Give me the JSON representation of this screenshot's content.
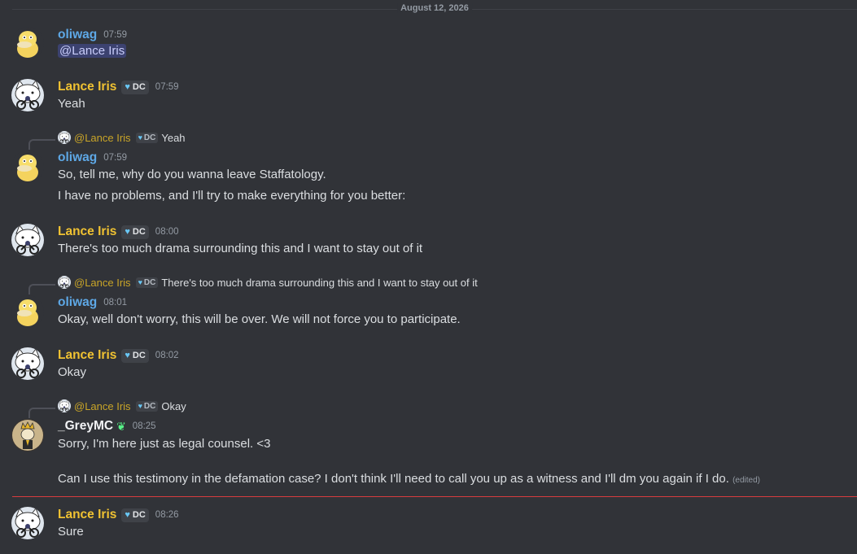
{
  "date_divider": "August 12, 2026",
  "users": {
    "oliwag": {
      "name": "oliwag"
    },
    "lance": {
      "name": "Lance Iris",
      "tag": "DC",
      "mention": "@Lance Iris"
    },
    "grey": {
      "name": "_GreyMC"
    }
  },
  "messages": [
    {
      "author": "oliwag",
      "time": "07:59",
      "text": "@Lance Iris"
    },
    {
      "author": "Lance Iris",
      "time": "07:59",
      "text": "Yeah"
    },
    {
      "author": "oliwag",
      "time": "07:59",
      "reply_text": "Yeah",
      "lines": [
        "So, tell me, why do you wanna leave Staffatology.",
        "I have no problems, and I'll try to make everything for you better:"
      ]
    },
    {
      "author": "Lance Iris",
      "time": "08:00",
      "text": "There's too much drama surrounding this and I want to stay out of it"
    },
    {
      "author": "oliwag",
      "time": "08:01",
      "reply_text": "There's too much drama surrounding this and I want to stay out of it",
      "text": "Okay, well don't worry, this will be over. We will not force you to participate."
    },
    {
      "author": "Lance Iris",
      "time": "08:02",
      "text": "Okay"
    },
    {
      "author": "_GreyMC",
      "time": "08:25",
      "reply_text": "Okay",
      "lines": [
        "Sorry, I'm here just as legal counsel. <3",
        "Can I use this testimony in the defamation case? I don't think I'll need to call you up as a witness and I'll dm you again if I do."
      ],
      "edited": "(edited)"
    },
    {
      "author": "Lance Iris",
      "time": "08:26",
      "text": "Sure"
    }
  ],
  "colors": {
    "background": "#313338",
    "oliwag": "#5ea8e6",
    "lance": "#f0c232",
    "new_divider": "#d83c3e"
  }
}
